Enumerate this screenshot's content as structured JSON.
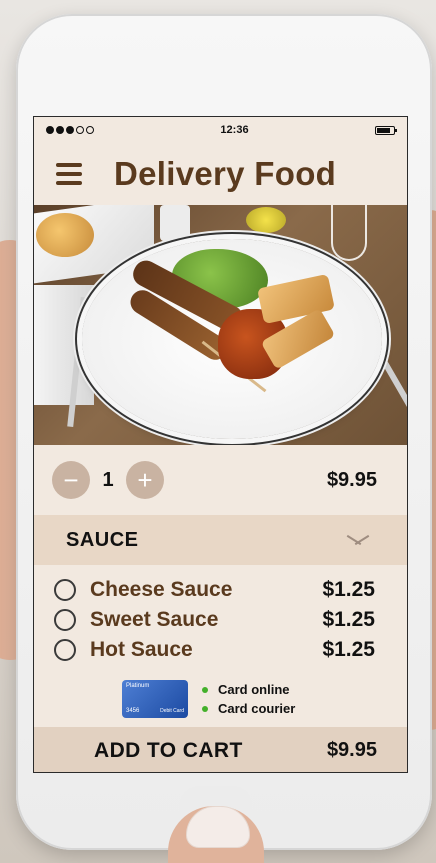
{
  "status_bar": {
    "time": "12:36"
  },
  "header": {
    "title": "Delivery Food"
  },
  "item": {
    "quantity": "1",
    "price": "$9.95",
    "minus": "−",
    "plus": "+"
  },
  "sauce_section": {
    "title": "SAUCE",
    "options": [
      {
        "name": "Cheese Sauce",
        "price": "$1.25"
      },
      {
        "name": "Sweet Sauce",
        "price": "$1.25"
      },
      {
        "name": "Hot Sauce",
        "price": "$1.25"
      }
    ]
  },
  "payment": {
    "card_brand": "Platinum",
    "card_number": "3456",
    "card_type": "Debit Card",
    "methods": [
      "Card online",
      "Card courier"
    ]
  },
  "cart": {
    "label": "ADD TO CART",
    "price": "$9.95"
  },
  "colors": {
    "brand_brown": "#5a3a1e",
    "cream_bg": "#f2e9e0",
    "accent_tan": "#e8d7c6",
    "button_taupe": "#c9b3a2",
    "pay_green": "#43b02a"
  }
}
